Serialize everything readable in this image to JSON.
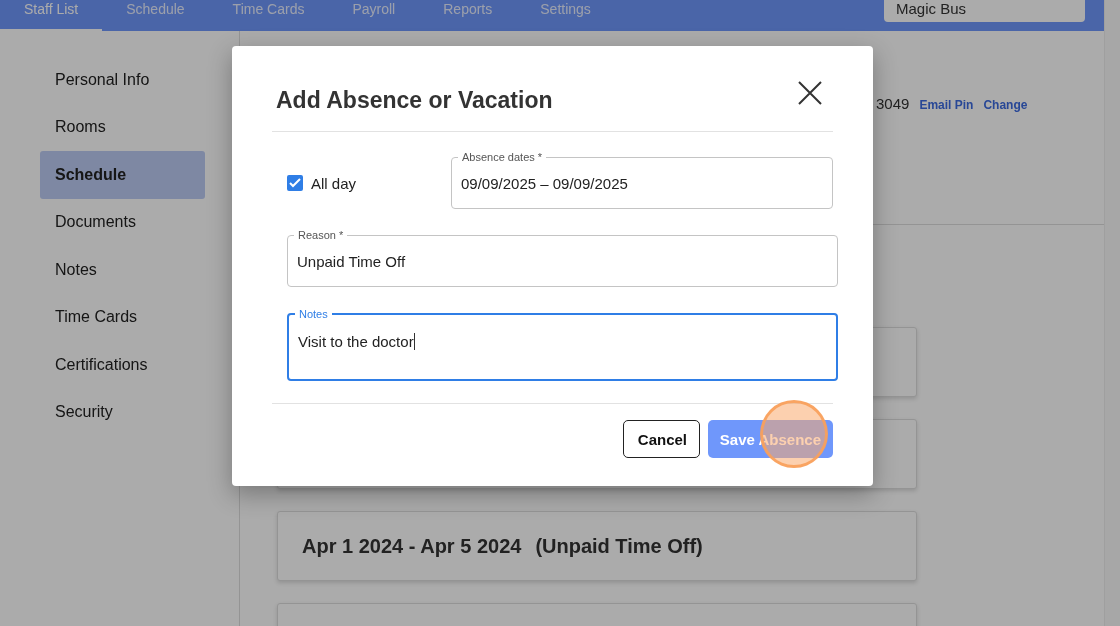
{
  "nav": {
    "tabs": [
      {
        "label": "Staff List",
        "selected": true
      },
      {
        "label": "Schedule",
        "selected": false
      },
      {
        "label": "Time Cards",
        "selected": false
      },
      {
        "label": "Payroll",
        "selected": false
      },
      {
        "label": "Reports",
        "selected": false
      },
      {
        "label": "Settings",
        "selected": false
      }
    ],
    "account_select": {
      "value": "Magic Bus"
    }
  },
  "sidebar": {
    "items": [
      {
        "label": "Personal Info",
        "selected": false
      },
      {
        "label": "Rooms",
        "selected": false
      },
      {
        "label": "Schedule",
        "selected": true
      },
      {
        "label": "Documents",
        "selected": false
      },
      {
        "label": "Notes",
        "selected": false
      },
      {
        "label": "Time Cards",
        "selected": false
      },
      {
        "label": "Certifications",
        "selected": false
      },
      {
        "label": "Security",
        "selected": false
      }
    ]
  },
  "header": {
    "pin": "3049",
    "links": [
      "Email Pin",
      "Change"
    ]
  },
  "absence_cards": [
    {
      "kind": "covered"
    },
    {
      "kind": "covered"
    },
    {
      "kind": "entry",
      "dates": "Apr 1 2024 - Apr 5 2024",
      "reason": "(Unpaid Time Off)"
    },
    {
      "kind": "covered"
    }
  ],
  "dialog": {
    "title": "Add Absence or Vacation",
    "all_day": {
      "label": "All day",
      "checked": true
    },
    "absence_dates": {
      "label": "Absence dates *",
      "value": "09/09/2025 – 09/09/2025"
    },
    "reason": {
      "label": "Reason *",
      "value": "Unpaid Time Off"
    },
    "notes": {
      "label": "Notes",
      "value": "Visit to the doctor",
      "focused": true
    },
    "buttons": [
      {
        "label": "Cancel",
        "kind": "outlined"
      },
      {
        "label": "Save Absence",
        "kind": "primary"
      }
    ],
    "click_marker": true
  }
}
